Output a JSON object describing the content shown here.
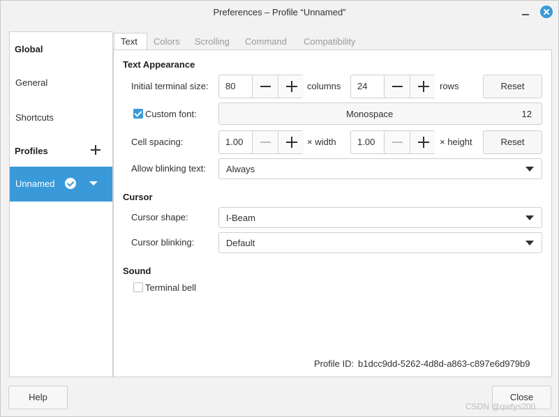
{
  "window": {
    "title": "Preferences – Profile “Unnamed”"
  },
  "sidebar": {
    "global_heading": "Global",
    "general": "General",
    "shortcuts": "Shortcuts",
    "profiles_heading": "Profiles",
    "profile_name": "Unnamed"
  },
  "tabs": [
    "Text",
    "Colors",
    "Scrolling",
    "Command",
    "Compatibility"
  ],
  "text_appearance": {
    "heading": "Text Appearance",
    "terminal_size_label": "Initial terminal size:",
    "columns_value": "80",
    "columns_label": "columns",
    "rows_value": "24",
    "rows_label": "rows",
    "reset_label": "Reset",
    "custom_font_label": "Custom font:",
    "font_name": "Monospace",
    "font_size": "12",
    "cell_spacing_label": "Cell spacing:",
    "width_value": "1.00",
    "width_label": "× width",
    "height_value": "1.00",
    "height_label": "× height",
    "blinking_text_label": "Allow blinking text:",
    "blinking_text_value": "Always"
  },
  "cursor": {
    "heading": "Cursor",
    "shape_label": "Cursor shape:",
    "shape_value": "I-Beam",
    "blinking_label": "Cursor blinking:",
    "blinking_value": "Default"
  },
  "sound": {
    "heading": "Sound",
    "terminal_bell_label": "Terminal bell"
  },
  "footer": {
    "profile_id_label": "Profile ID:",
    "profile_id_value": "b1dcc9dd-5262-4d8d-a863-c897e6d979b9",
    "help_label": "Help",
    "close_label": "Close",
    "watermark": "CSDN @qwfys200"
  },
  "colors": {
    "accent": "#3a9ad9"
  }
}
